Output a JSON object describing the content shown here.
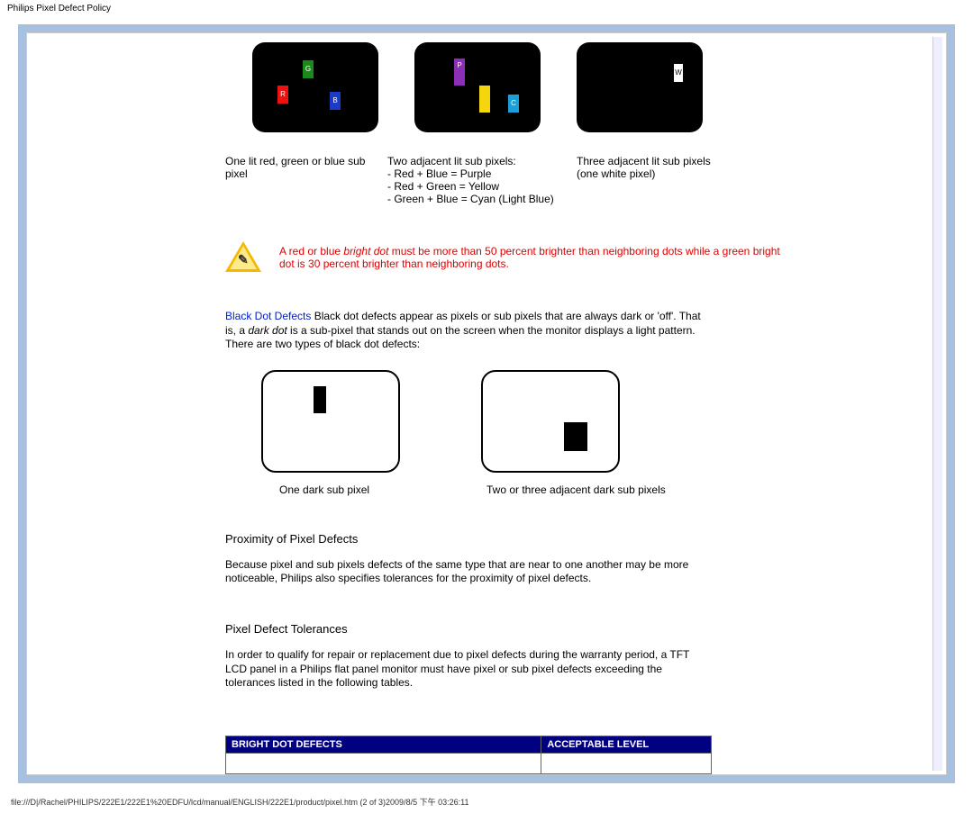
{
  "page_header": "Philips Pixel Defect Policy",
  "illust1": {
    "r": "R",
    "g": "G",
    "b": "B"
  },
  "illust2": {
    "p": "P",
    "c": "C"
  },
  "illust3": {
    "w": "W"
  },
  "captions": {
    "c1": "One lit red, green or blue sub pixel",
    "c2_line1": "Two adjacent lit sub pixels:",
    "c2_line2": "- Red + Blue = Purple",
    "c2_line3": "- Red + Green = Yellow",
    "c2_line4": "- Green + Blue = Cyan (Light Blue)",
    "c3_line1": "Three adjacent lit sub pixels",
    "c3_line2": "(one white pixel)"
  },
  "warning": {
    "pre": "A red or blue ",
    "em": "bright dot",
    "post": " must be more than 50 percent brighter than neighboring dots while a green bright dot is 30 percent brighter than neighboring dots."
  },
  "black_dot": {
    "label": "Black Dot Defects",
    "text1": " Black dot defects appear as pixels or sub pixels that are always dark or 'off'. That is, a ",
    "em": "dark dot",
    "text2": " is a sub-pixel that stands out on the screen when the monitor displays a light pattern. There are two types of black dot defects:"
  },
  "dark_captions": {
    "d1": "One dark sub pixel",
    "d2": "Two or three adjacent dark sub pixels"
  },
  "proximity": {
    "h": "Proximity of Pixel Defects",
    "p": "Because pixel and sub pixels defects of the same type that are near to one another may be more noticeable, Philips also specifies tolerances for the proximity of pixel defects."
  },
  "tolerances": {
    "h": "Pixel Defect Tolerances",
    "p": "In order to qualify for repair or replacement due to pixel defects during the warranty period, a TFT LCD panel in a Philips flat panel monitor must have pixel or sub pixel defects exceeding the tolerances listed in the following tables."
  },
  "table": {
    "th1": "BRIGHT DOT DEFECTS",
    "th2": "ACCEPTABLE LEVEL"
  },
  "footer": "file:///D|/Rachel/PHILIPS/222E1/222E1%20EDFU/lcd/manual/ENGLISH/222E1/product/pixel.htm (2 of 3)2009/8/5 下午 03:26:11"
}
